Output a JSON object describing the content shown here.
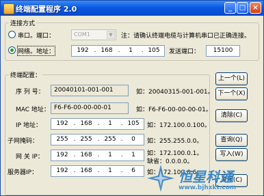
{
  "window": {
    "title": "终端配置程序 2.0",
    "minimize_label": "_",
    "maximize_label": "□",
    "close_label": "×"
  },
  "connection": {
    "group_label": "连接方式",
    "serial_label": "串口。端口：",
    "serial_checked": false,
    "serial_port_value": "COM1",
    "serial_note": "注：请确认终端电缆与计算机串口已正确连接。",
    "network_label": "网络。地址：",
    "network_checked": true,
    "ip": [
      "192",
      "168",
      "1",
      "105"
    ],
    "send_port_label": "发送端口：",
    "send_port_value": "15100"
  },
  "terminal": {
    "group_label": "终端配置：",
    "rows": [
      {
        "label": "序 列 号：",
        "value": "20040101-001-001",
        "example": "如：20040315-001-001。"
      },
      {
        "label": "MAC 地址：",
        "value": "F6-F6-00-00-00-01",
        "example": "如：F6-F6-00-00-00-01。"
      },
      {
        "label": "IP  地址：",
        "ip": [
          "192",
          "168",
          "1",
          "105"
        ],
        "example": "如：172.100.0.100。"
      },
      {
        "label": "子网掩码：",
        "ip": [
          "255",
          "255",
          "255",
          "0"
        ],
        "example": "如：255.255.0.0。"
      },
      {
        "label": "网 关 IP：",
        "ip": [
          "192",
          "168",
          "1",
          "1"
        ],
        "example": "如：172.100.0.1。",
        "example2": "缺省：0.0.0.0。"
      },
      {
        "label": "服务器IP：",
        "ip": [
          "192",
          "168",
          "1",
          "6"
        ],
        "example": "如：172.100.0.6。"
      }
    ]
  },
  "buttons": {
    "prev": "上一个(L)",
    "next": "下一个(X)",
    "clear": "清除(C)",
    "query": "查询(Q)",
    "write": "写入(W)",
    "close": "关闭(C)"
  },
  "watermark": {
    "name": "恒星科通",
    "url": "www.bjhxkt.com"
  }
}
